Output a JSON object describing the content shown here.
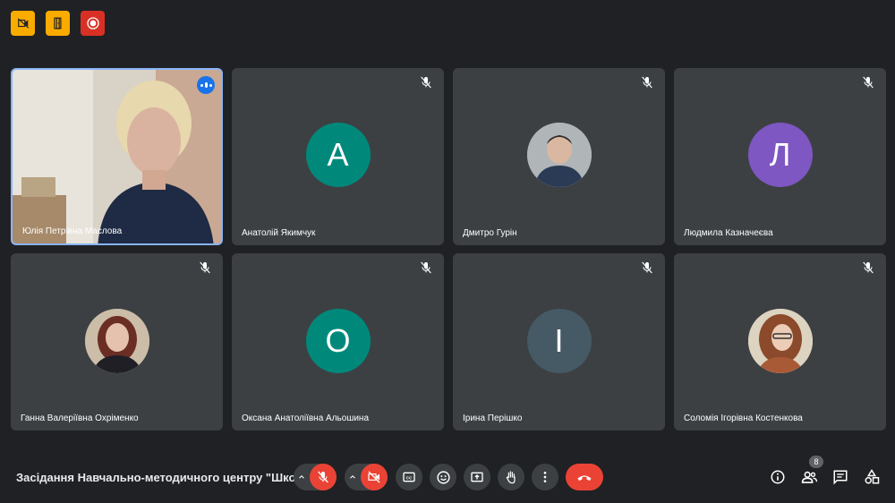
{
  "top_bar": {
    "icons": [
      "no-video-icon",
      "door-icon",
      "record-icon"
    ]
  },
  "participants": [
    {
      "name": "Юлія Петрівна Маслова",
      "type": "video",
      "speaking": true
    },
    {
      "name": "Анатолій Якимчук",
      "type": "initial",
      "initial": "A",
      "color": "#00897b",
      "muted": true
    },
    {
      "name": "Дмитро Гурін",
      "type": "photo",
      "muted": true
    },
    {
      "name": "Людмила Казначеєва",
      "type": "initial",
      "initial": "Л",
      "color": "#7e57c2",
      "muted": true
    },
    {
      "name": "Ганна Валеріївна Охріменко",
      "type": "photo",
      "muted": true
    },
    {
      "name": "Оксана Анатоліївна Альошина",
      "type": "initial",
      "initial": "О",
      "color": "#00897b",
      "muted": true
    },
    {
      "name": "Ірина Перішко",
      "type": "initial",
      "initial": "І",
      "color": "#455a64",
      "muted": true
    },
    {
      "name": "Соломія Ігорівна Костенкова",
      "type": "photo",
      "muted": true
    }
  ],
  "bottom_bar": {
    "meeting_title": "Засідання Навчально-методичного центру \"Школ...",
    "participant_count": "8",
    "controls": [
      "mic-off",
      "camera-off",
      "captions",
      "emoji",
      "present",
      "raise-hand",
      "more-options",
      "leave-call"
    ],
    "right_icons": [
      "info",
      "people",
      "chat",
      "activities"
    ],
    "colors": {
      "danger": "#ea4335",
      "accent": "#8ab4f8",
      "surface": "#3c4043",
      "background": "#202124"
    }
  }
}
